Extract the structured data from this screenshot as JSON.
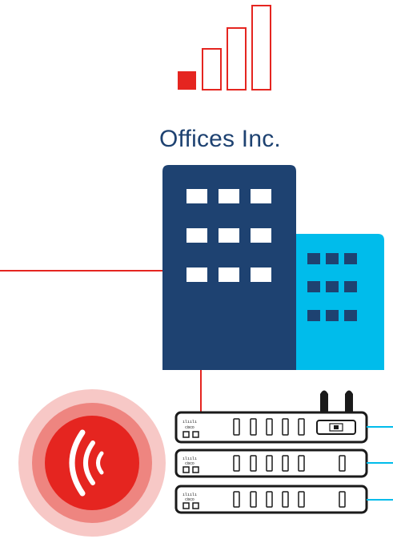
{
  "company": {
    "name": "Offices Inc."
  },
  "signal_indicator": {
    "bars_total": 4,
    "bars_filled": 1
  },
  "router_stack": {
    "brand_label": "cisco",
    "units": [
      {
        "ports": 4,
        "has_antennas": true,
        "has_sim_slot": true
      },
      {
        "ports": 6,
        "has_antennas": false,
        "has_sim_slot": false
      },
      {
        "ports": 6,
        "has_antennas": false,
        "has_sim_slot": false
      }
    ]
  },
  "colors": {
    "accent_red": "#e52520",
    "building_main": "#1e4271",
    "building_side": "#00bceb",
    "window": "#ffffff",
    "router_outline": "#1a1a1a",
    "link_blue": "#00bceb"
  },
  "icons": [
    "signal-strength-icon",
    "office-building-icon",
    "wireless-alert-icon",
    "router-icon"
  ]
}
